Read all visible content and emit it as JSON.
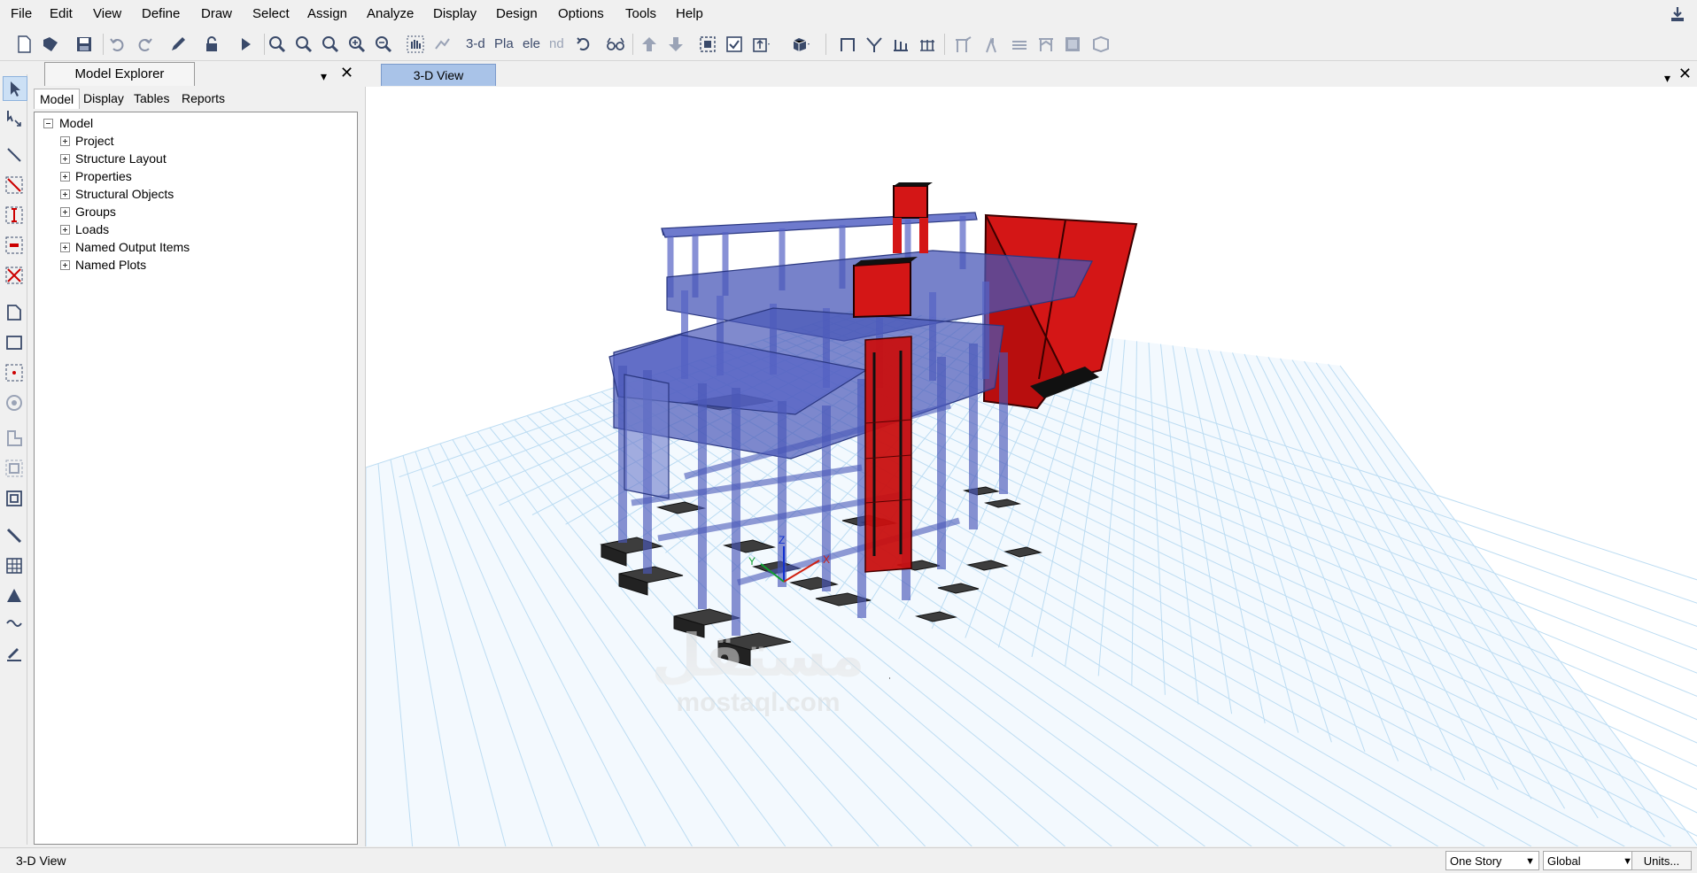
{
  "menu": [
    "File",
    "Edit",
    "View",
    "Define",
    "Draw",
    "Select",
    "Assign",
    "Analyze",
    "Display",
    "Design",
    "Options",
    "Tools",
    "Help"
  ],
  "toolbar": {
    "text_buttons": {
      "view_3d": "3-d",
      "plan": "Pla",
      "elev": "ele",
      "nd": "nd"
    }
  },
  "explorer": {
    "title": "Model Explorer",
    "tabs": [
      "Model",
      "Display",
      "Tables",
      "Reports"
    ],
    "active_tab": "Model",
    "close_glyph": "✕",
    "dropdown_glyph": "▾",
    "tree": {
      "root": "Model",
      "children": [
        "Project",
        "Structure Layout",
        "Properties",
        "Structural Objects",
        "Groups",
        "Loads",
        "Named Output Items",
        "Named Plots"
      ]
    }
  },
  "view": {
    "tab_label": "3-D View",
    "close_glyph": "✕",
    "dropdown_glyph": "▾",
    "axes": {
      "x": "X",
      "y": "Y",
      "z": "Z"
    },
    "watermark": {
      "arabic": "مستقل",
      "latin": "mostaql.com"
    }
  },
  "statusbar": {
    "text": "3-D View",
    "story_select": "One Story",
    "coord_select": "Global",
    "units_button": "Units..."
  },
  "colors": {
    "frame_blue": "#4a58b8",
    "wall_red": "#c81010",
    "grid_line": "#bcdcf2",
    "view_tab": "#a9c3e8"
  }
}
